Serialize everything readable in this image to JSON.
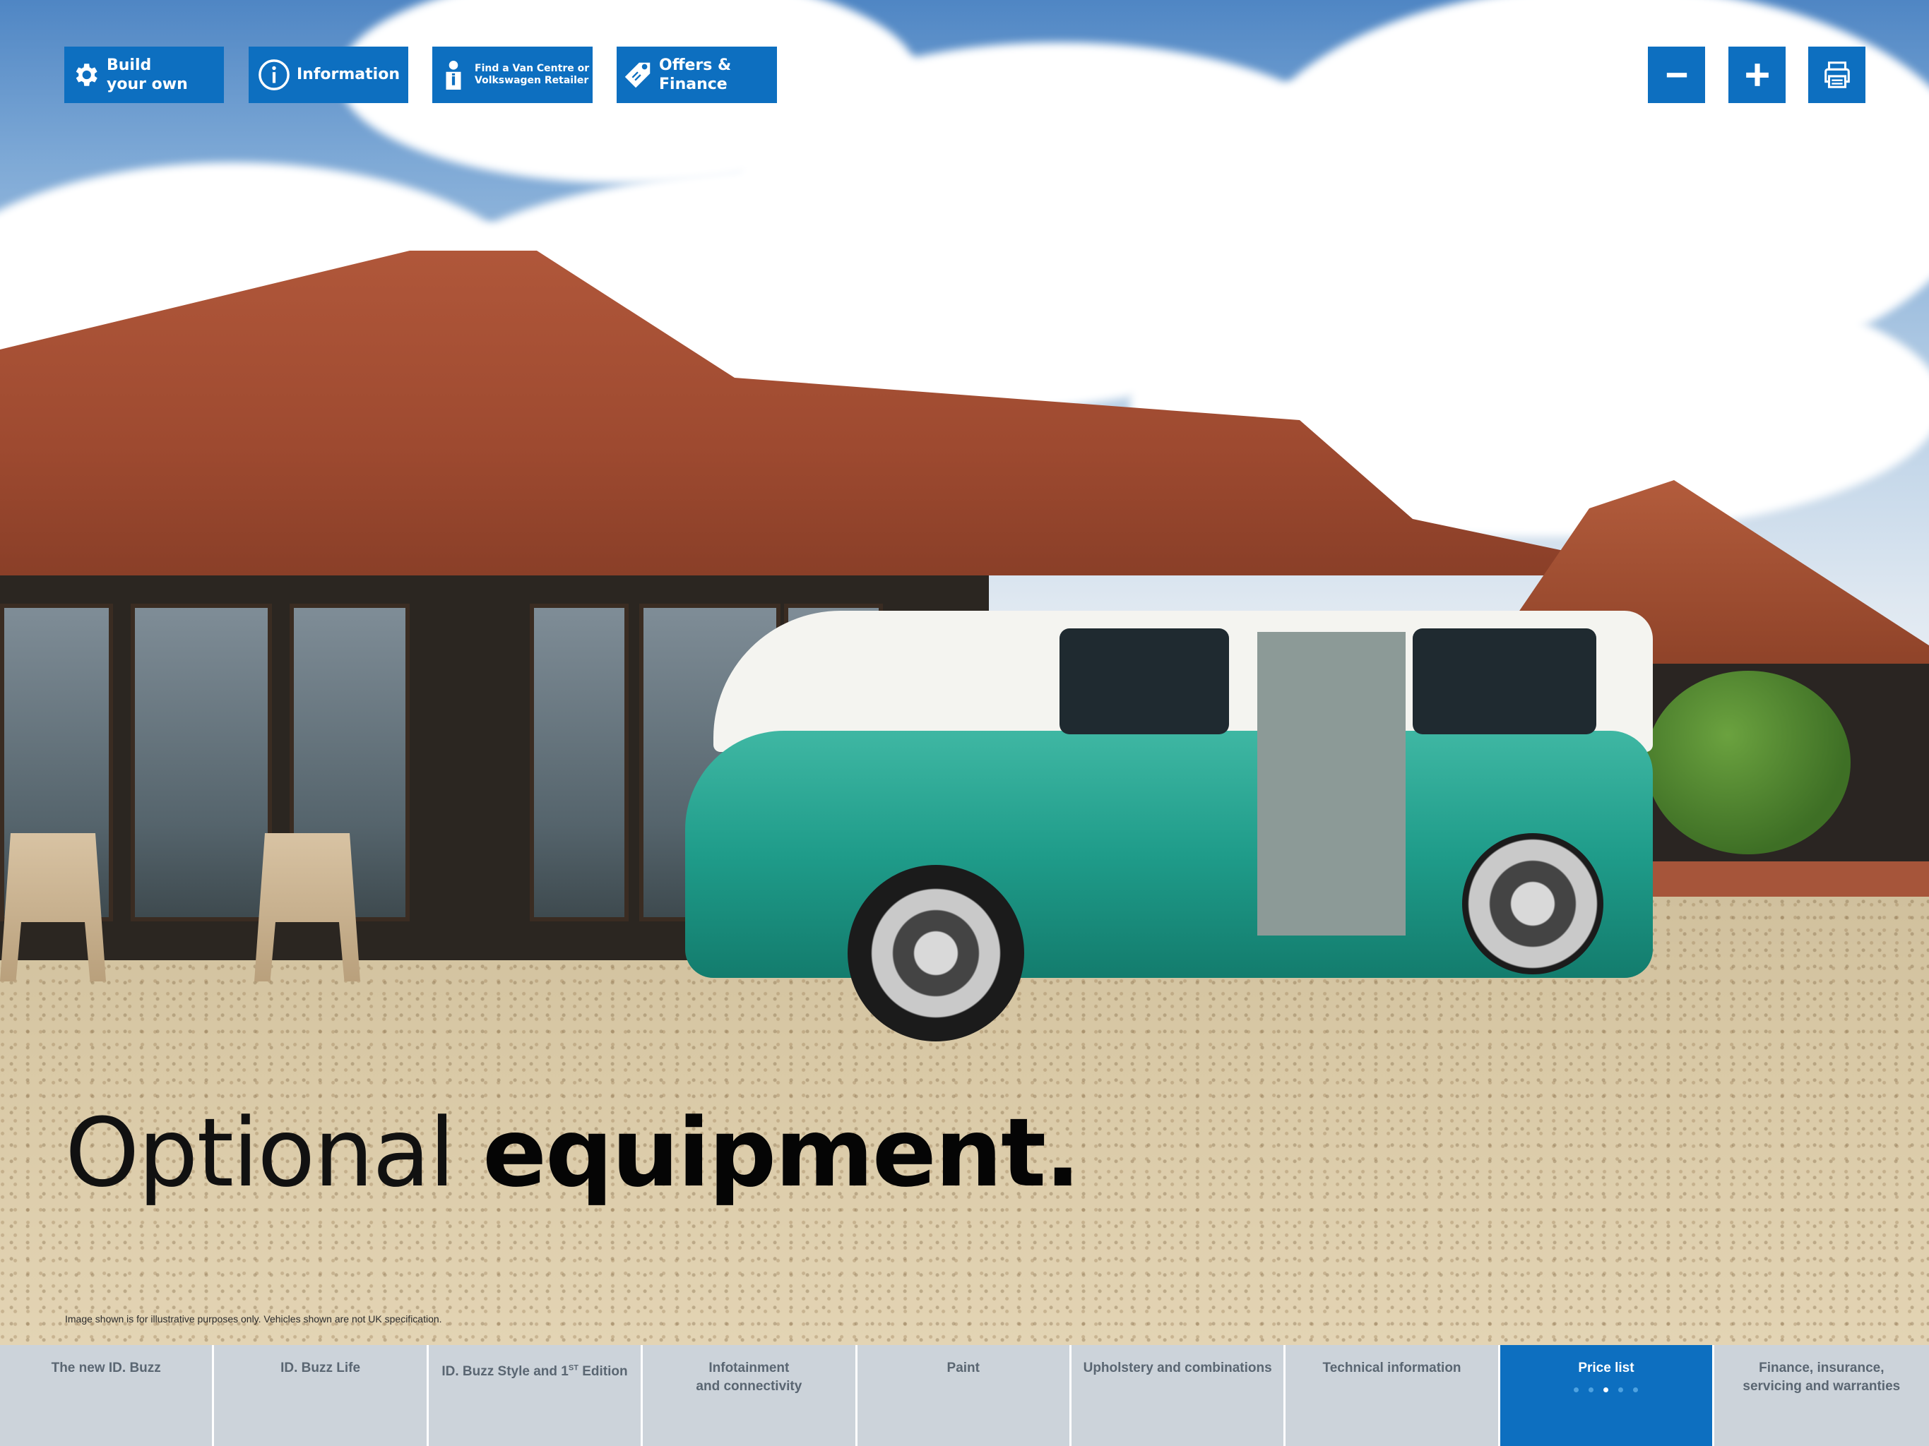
{
  "toolbar": {
    "build": {
      "line1": "Build",
      "line2": "your own",
      "icon": "gear-icon"
    },
    "information": {
      "label": "Information",
      "icon": "info-icon"
    },
    "find": {
      "line1": "Find a Van Centre  or",
      "line2": "Volkswagen Retailer",
      "icon": "person-icon"
    },
    "offers": {
      "line1": "Offers &",
      "line2": "Finance",
      "icon": "tag-icon"
    },
    "zoom_out_icon": "minus-icon",
    "zoom_in_icon": "plus-icon",
    "print_icon": "printer-icon",
    "color": "#0d6fc0"
  },
  "headline": {
    "light": "Optional",
    "bold": "equipment."
  },
  "disclaimer": "Image shown is for illustrative purposes only. Vehicles shown are not UK specification.",
  "nav": {
    "tabs": [
      {
        "line1": "The new ID. Buzz",
        "line2": ""
      },
      {
        "line1": "ID. Buzz Life",
        "line2": ""
      },
      {
        "line1": "ID. Buzz Style and 1",
        "sup": "ST",
        "line1b": " Edition",
        "line2": ""
      },
      {
        "line1": "Infotainment",
        "line2": "and connectivity"
      },
      {
        "line1": "Paint",
        "line2": ""
      },
      {
        "line1": "Upholstery and combinations",
        "line2": ""
      },
      {
        "line1": "Technical information",
        "line2": ""
      },
      {
        "line1": "Price list",
        "line2": "",
        "active": true
      },
      {
        "line1": "Finance, insurance,",
        "line2": "servicing and warranties"
      }
    ],
    "page_dots": {
      "total": 5,
      "current": 3
    },
    "active_color": "#0d6fc0",
    "inactive_color": "#ccd3da"
  }
}
